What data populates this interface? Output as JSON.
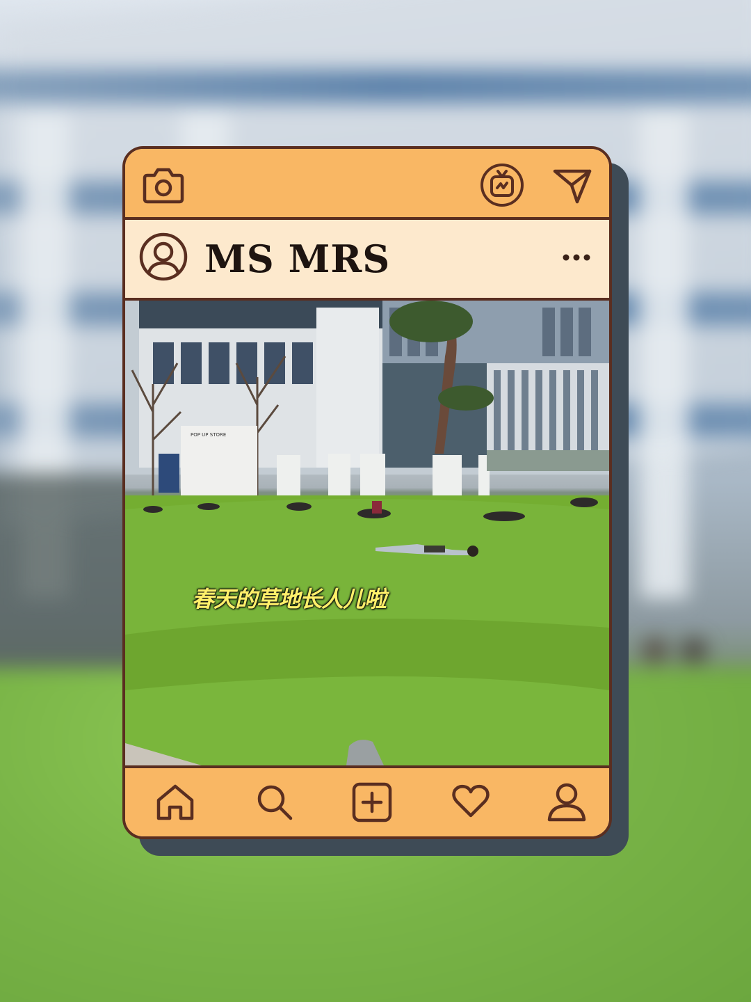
{
  "profile": {
    "username": "MS MRS"
  },
  "post": {
    "caption": "春天的草地长人儿啦",
    "photo_sign": "POP UP STORE"
  },
  "topbar": {
    "left_icon": "camera-icon",
    "right_icons": [
      "igtv-icon",
      "send-icon"
    ]
  },
  "profile_bar": {
    "avatar_icon": "user-circle-icon",
    "menu_icon": "more-horizontal-icon"
  },
  "bottombar": {
    "icons": [
      "home-icon",
      "search-icon",
      "add-post-icon",
      "heart-icon",
      "profile-icon"
    ]
  },
  "colors": {
    "bar": "#f9b764",
    "profile_bar": "#fde9cd",
    "outline": "#5a2e20",
    "card_shadow": "#3e4b56",
    "caption_text": "#fff06a"
  }
}
